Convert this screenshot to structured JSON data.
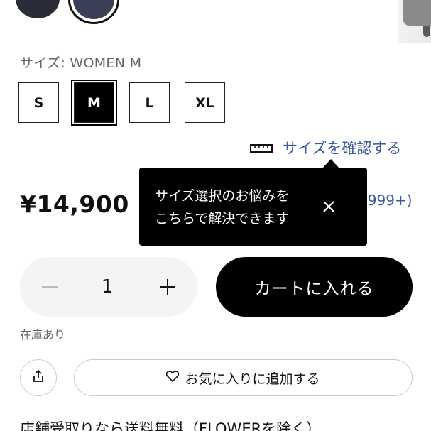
{
  "colors": {
    "accent_link": "#3a5a9a",
    "cart_button": "#000000",
    "tooltip_bg": "#000000",
    "stepper_bg": "#f4f4f4"
  },
  "color_swatches": [
    {
      "name": "dark-navy"
    },
    {
      "name": "navy-selected"
    }
  ],
  "size": {
    "label": "サイズ: WOMEN M",
    "options": [
      "S",
      "M",
      "L",
      "XL"
    ],
    "selected": "M"
  },
  "size_guide": {
    "icon": "ruler-icon",
    "label": "サイズを確認する"
  },
  "price": "¥14,900",
  "reviews": {
    "count_text": "(999+)"
  },
  "tooltip": {
    "line1": "サイズ選択のお悩みを",
    "line2": "こちらで解決できます",
    "close_icon": "close-icon"
  },
  "quantity": {
    "value": "1",
    "minus_icon": "minus-icon",
    "plus_icon": "plus-icon"
  },
  "add_to_cart": "カートに入れる",
  "stock_status": "在庫あり",
  "share_icon": "share-icon",
  "favorite": {
    "icon": "heart-icon",
    "label": "お気に入りに追加する"
  },
  "promo_text": "店舗受取りなら送料無料（FLOWERを除く）"
}
